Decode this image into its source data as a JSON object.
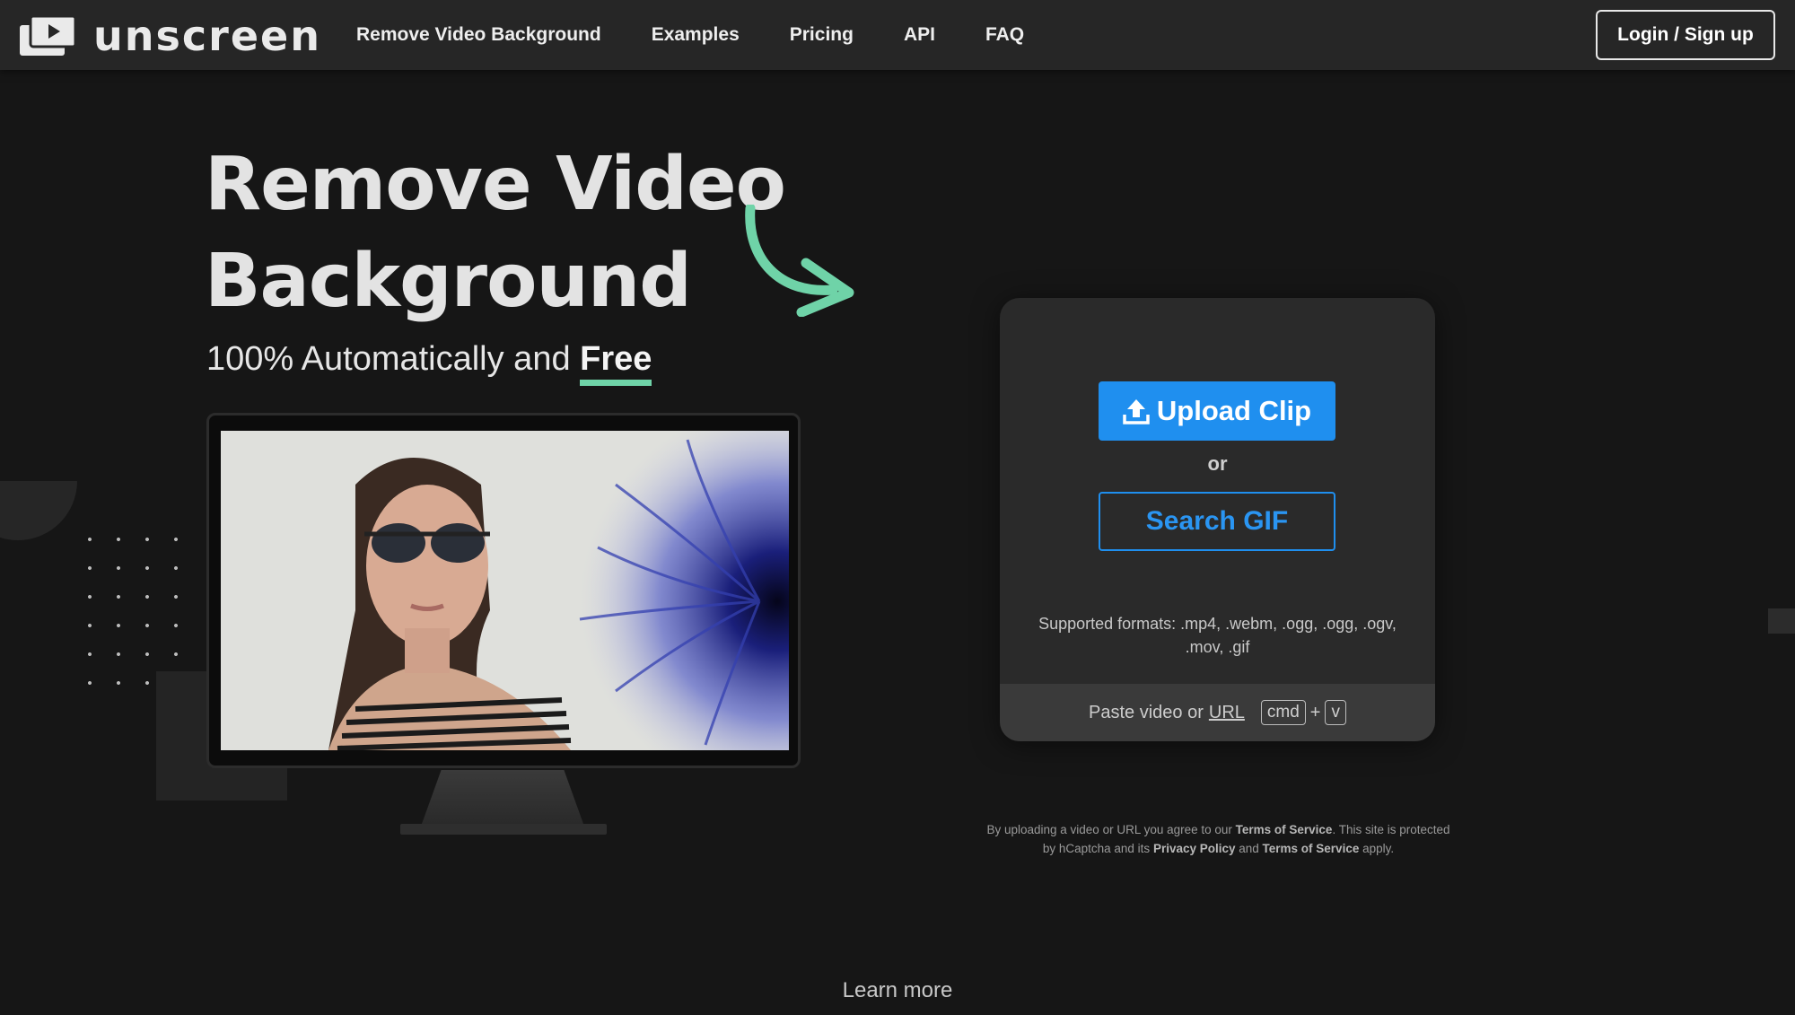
{
  "brand": {
    "name": "unscreen"
  },
  "nav": {
    "links": [
      "Remove Video Background",
      "Examples",
      "Pricing",
      "API",
      "FAQ"
    ],
    "login_label": "Login / Sign up"
  },
  "hero": {
    "title_line1": "Remove Video",
    "title_line2": "Background",
    "subtitle_prefix": "100% Automatically and ",
    "subtitle_emphasis": "Free"
  },
  "upload_card": {
    "upload_label": "Upload Clip",
    "or_label": "or",
    "search_label": "Search GIF",
    "formats_line1": "Supported formats: .mp4, .webm, .ogg, .ogg, .ogv,",
    "formats_line2": ".mov, .gif",
    "paste_prefix": "Paste video or",
    "paste_url": "URL",
    "key_cmd": "cmd",
    "key_plus": "+",
    "key_v": "v"
  },
  "terms": {
    "t1": "By uploading a video or URL you agree to our ",
    "tos": "Terms of Service",
    "t2": ". This site is protected",
    "t3": "by hCaptcha and its ",
    "privacy": "Privacy Policy",
    "t4": " and ",
    "tos2": "Terms of Service",
    "t5": " apply."
  },
  "footer": {
    "learn_more": "Learn more"
  },
  "colors": {
    "accent_blue": "#1f8fef",
    "accent_green": "#6fd3a8",
    "background": "#161616",
    "nav": "#262626"
  },
  "icons": {
    "logo": "play-window-icon",
    "upload": "upload-icon",
    "arrow": "curved-arrow-icon"
  }
}
